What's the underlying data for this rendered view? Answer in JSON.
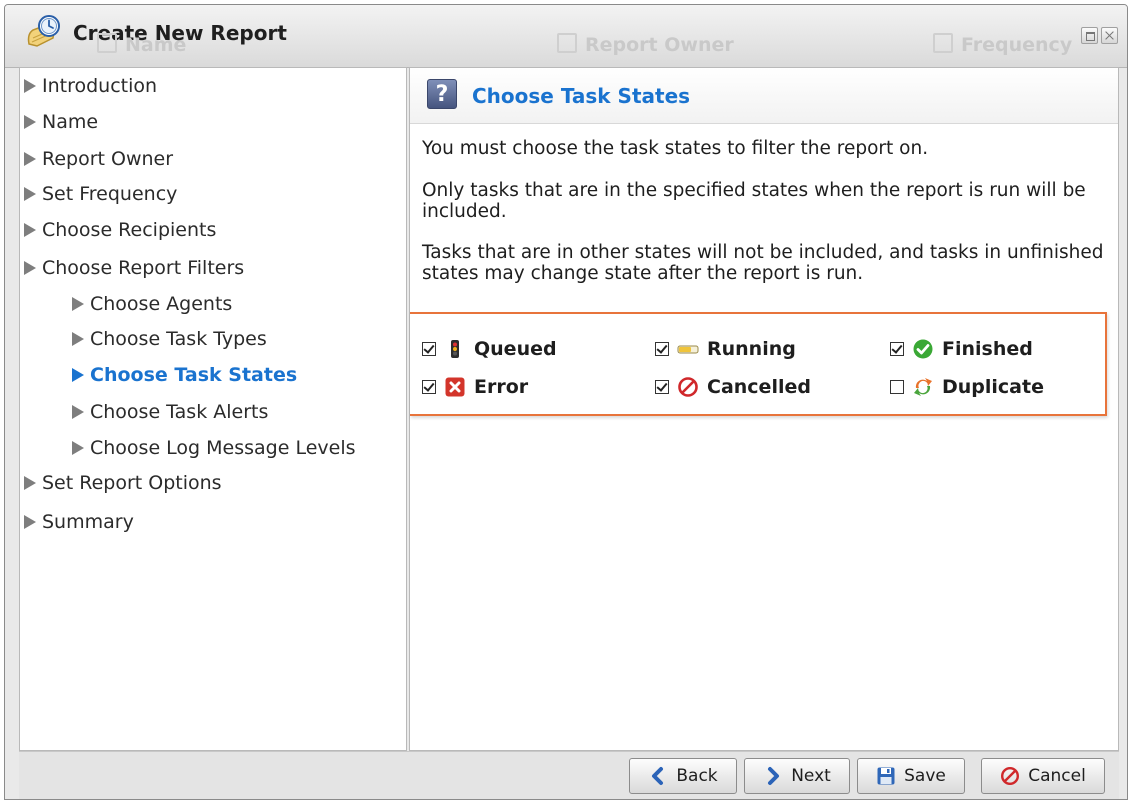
{
  "window": {
    "title": "Create New Report",
    "background_tabs": [
      "Name",
      "Report Owner",
      "Frequency"
    ]
  },
  "nav": {
    "items": [
      {
        "label": "Introduction",
        "level": 0,
        "active": false
      },
      {
        "label": "Name",
        "level": 0,
        "active": false
      },
      {
        "label": "Report Owner",
        "level": 0,
        "active": false
      },
      {
        "label": "Set Frequency",
        "level": 0,
        "active": false
      },
      {
        "label": "Choose Recipients",
        "level": 0,
        "active": false
      },
      {
        "label": "Choose Report Filters",
        "level": 0,
        "active": false
      },
      {
        "label": "Choose Agents",
        "level": 1,
        "active": false
      },
      {
        "label": "Choose Task Types",
        "level": 1,
        "active": false
      },
      {
        "label": "Choose Task States",
        "level": 1,
        "active": true
      },
      {
        "label": "Choose Task Alerts",
        "level": 1,
        "active": false
      },
      {
        "label": "Choose Log Message Levels",
        "level": 1,
        "active": false
      },
      {
        "label": "Set Report Options",
        "level": 0,
        "active": false
      },
      {
        "label": "Summary",
        "level": 0,
        "active": false
      }
    ]
  },
  "main": {
    "header_icon": "question-icon",
    "title": "Choose Task States",
    "paragraphs": [
      "You must choose the task states to filter the report on.",
      "Only tasks that are in the specified states when the report is run will be included.",
      "Tasks that are in other states will not be included, and tasks in unfinished states may change state after the report is run."
    ],
    "states": [
      {
        "label": "Queued",
        "checked": true,
        "icon": "traffic-light-icon"
      },
      {
        "label": "Running",
        "checked": true,
        "icon": "progress-bar-icon"
      },
      {
        "label": "Finished",
        "checked": true,
        "icon": "green-check-icon"
      },
      {
        "label": "Error",
        "checked": true,
        "icon": "red-x-icon"
      },
      {
        "label": "Cancelled",
        "checked": true,
        "icon": "cancel-circle-icon"
      },
      {
        "label": "Duplicate",
        "checked": false,
        "icon": "duplicate-icon"
      }
    ]
  },
  "buttons": {
    "back": "Back",
    "next": "Next",
    "save": "Save",
    "cancel": "Cancel"
  },
  "colors": {
    "accent": "#1a73cf",
    "highlight_border": "#e8743b",
    "cancel_red": "#d0282b"
  }
}
